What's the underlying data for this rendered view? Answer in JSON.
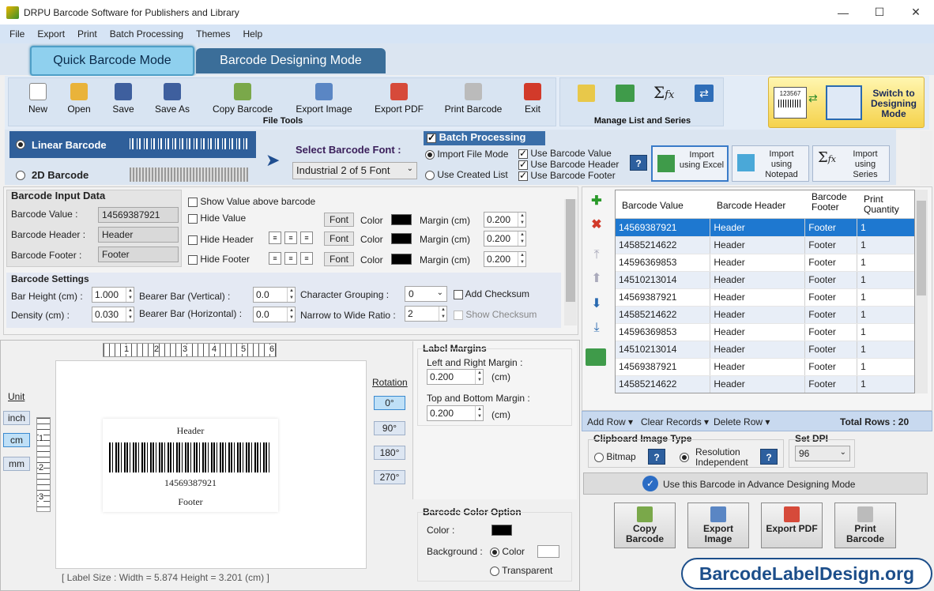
{
  "window": {
    "title": "DRPU Barcode Software for Publishers and Library",
    "min": "—",
    "max": "☐",
    "close": "✕"
  },
  "menu": [
    "File",
    "Export",
    "Print",
    "Batch Processing",
    "Themes",
    "Help"
  ],
  "modes": {
    "quick": "Quick Barcode Mode",
    "designing": "Barcode Designing Mode"
  },
  "file_tools": {
    "label": "File Tools",
    "buttons": [
      "New",
      "Open",
      "Save",
      "Save As",
      "Copy Barcode",
      "Export Image",
      "Export PDF",
      "Print Barcode",
      "Exit"
    ]
  },
  "manage_list": {
    "label": "Manage List and Series"
  },
  "switch_mode": {
    "label": "Switch to Designing Mode",
    "sample": "123567"
  },
  "barcode_type": {
    "linear": "Linear Barcode",
    "twod": "2D Barcode"
  },
  "font_select": {
    "label": "Select Barcode Font :",
    "value": "Industrial 2 of 5 Font"
  },
  "batch": {
    "title": "Batch Processing",
    "import_file_mode": "Import File Mode",
    "use_created_list": "Use Created List",
    "use_value": "Use Barcode Value",
    "use_header": "Use Barcode Header",
    "use_footer": "Use Barcode Footer",
    "help": "?",
    "import_excel": "Import using Excel",
    "import_notepad": "Import using Notepad",
    "import_series": "Import using Series"
  },
  "input_data": {
    "title": "Barcode Input Data",
    "value_label": "Barcode Value :",
    "value": "14569387921",
    "header_label": "Barcode Header :",
    "header": "Header",
    "footer_label": "Barcode Footer :",
    "footer": "Footer",
    "show_above": "Show Value above barcode",
    "hide_value": "Hide Value",
    "hide_header": "Hide Header",
    "hide_footer": "Hide Footer",
    "font": "Font",
    "color": "Color",
    "margin": "Margin (cm)",
    "m1": "0.200",
    "m2": "0.200",
    "m3": "0.200"
  },
  "settings": {
    "title": "Barcode Settings",
    "bar_height_label": "Bar Height (cm) :",
    "bar_height": "1.000",
    "density_label": "Density (cm) :",
    "density": "0.030",
    "bearer_v_label": "Bearer Bar (Vertical) :",
    "bearer_v": "0.0",
    "bearer_h_label": "Bearer Bar (Horizontal) :",
    "bearer_h": "0.0",
    "char_group_label": "Character Grouping :",
    "char_group": "0",
    "narrow_label": "Narrow to Wide Ratio :",
    "narrow": "2",
    "add_checksum": "Add Checksum",
    "show_checksum": "Show Checksum"
  },
  "canvas": {
    "unit_label": "Unit",
    "units": [
      "inch",
      "cm",
      "mm"
    ],
    "ruler": [
      "1",
      "2",
      "3",
      "4",
      "5",
      "6"
    ],
    "vruler": [
      "1",
      "2",
      "3"
    ],
    "header": "Header",
    "value": "14569387921",
    "footer": "Footer",
    "label_size": "[ Label Size : Width = 5.874  Height = 3.201 (cm) ]"
  },
  "rotation": {
    "label": "Rotation",
    "options": [
      "0°",
      "90°",
      "180°",
      "270°"
    ]
  },
  "label_margins": {
    "title": "Label Margins",
    "lr_label": "Left and Right Margin :",
    "lr": "0.200",
    "tb_label": "Top and Bottom Margin :",
    "tb": "0.200",
    "unit": "(cm)"
  },
  "color_option": {
    "title": "Barcode Color Option",
    "color": "Color :",
    "background": "Background :",
    "bg_color": "Color",
    "transparent": "Transparent"
  },
  "table": {
    "columns": [
      "Barcode Value",
      "Barcode Header",
      "Barcode Footer",
      "Print Quantity"
    ],
    "rows": [
      [
        "14569387921",
        "Header",
        "Footer",
        "1"
      ],
      [
        "14585214622",
        "Header",
        "Footer",
        "1"
      ],
      [
        "14596369853",
        "Header",
        "Footer",
        "1"
      ],
      [
        "14510213014",
        "Header",
        "Footer",
        "1"
      ],
      [
        "14569387921",
        "Header",
        "Footer",
        "1"
      ],
      [
        "14585214622",
        "Header",
        "Footer",
        "1"
      ],
      [
        "14596369853",
        "Header",
        "Footer",
        "1"
      ],
      [
        "14510213014",
        "Header",
        "Footer",
        "1"
      ],
      [
        "14569387921",
        "Header",
        "Footer",
        "1"
      ],
      [
        "14585214622",
        "Header",
        "Footer",
        "1"
      ]
    ],
    "add_row": "Add Row",
    "clear_records": "Clear Records",
    "delete_row": "Delete Row",
    "total_rows": "Total Rows : 20"
  },
  "clipboard": {
    "title": "Clipboard Image Type",
    "bitmap": "Bitmap",
    "resolution": "Resolution Independent",
    "help": "?"
  },
  "dpi": {
    "title": "Set DPI",
    "value": "96"
  },
  "advance": "Use this Barcode in Advance Designing Mode",
  "bottom_buttons": [
    "Copy Barcode",
    "Export Image",
    "Export PDF",
    "Print Barcode"
  ],
  "brand": "BarcodeLabelDesign.org"
}
